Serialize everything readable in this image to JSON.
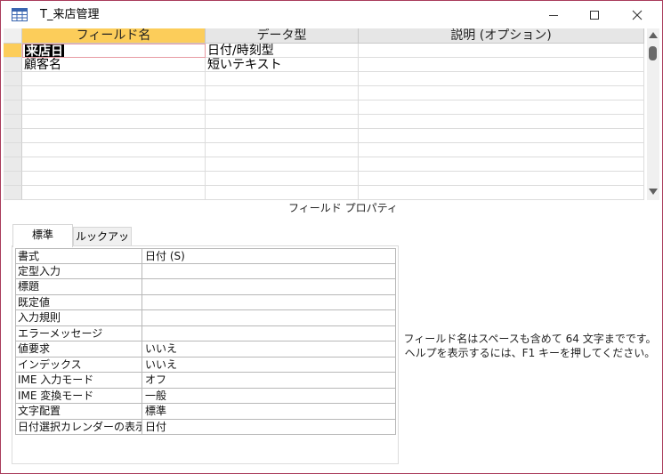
{
  "window": {
    "title": "T_来店管理",
    "icon": "table-icon",
    "controls": [
      "minimize-icon",
      "maximize-icon",
      "close-icon"
    ]
  },
  "grid": {
    "columns": [
      {
        "label": "フィールド名"
      },
      {
        "label": "データ型"
      },
      {
        "label": "説明 (オプション)"
      }
    ],
    "rows": [
      {
        "field_name": "来店日",
        "data_type": "日付/時刻型",
        "description": ""
      },
      {
        "field_name": "顧客名",
        "data_type": "短いテキスト",
        "description": ""
      }
    ]
  },
  "field_properties": {
    "title": "フィールド プロパティ",
    "tabs": [
      {
        "label": "標準"
      },
      {
        "label": "ルックアップ"
      }
    ],
    "properties": [
      {
        "label": "書式",
        "value": "日付 (S)"
      },
      {
        "label": "定型入力",
        "value": ""
      },
      {
        "label": "標題",
        "value": ""
      },
      {
        "label": "既定値",
        "value": ""
      },
      {
        "label": "入力規則",
        "value": ""
      },
      {
        "label": "エラーメッセージ",
        "value": ""
      },
      {
        "label": "値要求",
        "value": "いいえ"
      },
      {
        "label": "インデックス",
        "value": "いいえ"
      },
      {
        "label": "IME 入力モード",
        "value": "オフ"
      },
      {
        "label": "IME 変換モード",
        "value": "一般"
      },
      {
        "label": "文字配置",
        "value": "標準"
      },
      {
        "label": "日付選択カレンダーの表示",
        "value": "日付"
      }
    ],
    "help_line1": "フィールド名はスペースも含めて 64 文字までです。",
    "help_line2": "ヘルプを表示するには、F1 キーを押してください。"
  },
  "colors": {
    "accent": "#fccd5a",
    "window_border": "#a93b5b"
  }
}
